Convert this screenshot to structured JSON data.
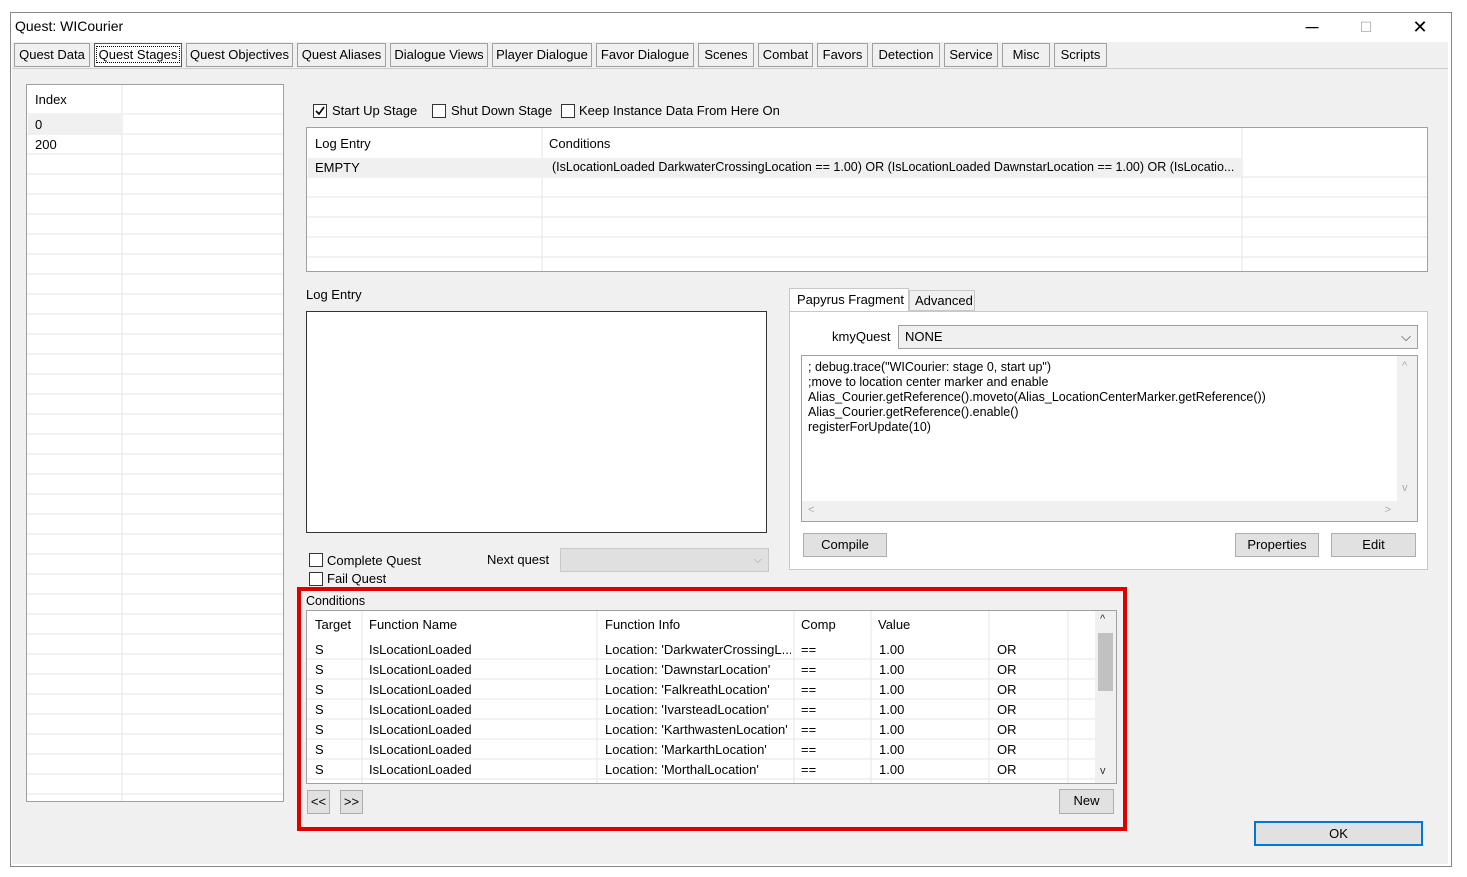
{
  "window": {
    "title": "Quest: WICourier",
    "min_label": "─",
    "max_label": "☐",
    "close_label": "✕"
  },
  "tabs": [
    "Quest Data",
    "Quest Stages",
    "Quest Objectives",
    "Quest Aliases",
    "Dialogue Views",
    "Player Dialogue",
    "Favor Dialogue",
    "Scenes",
    "Combat",
    "Favors",
    "Detection",
    "Service",
    "Misc",
    "Scripts"
  ],
  "index_list": {
    "header": "Index",
    "items": [
      "0",
      "200"
    ]
  },
  "stage_flags": {
    "start_up": "Start Up Stage",
    "shut_down": "Shut Down Stage",
    "keep_instance": "Keep Instance Data From Here On"
  },
  "log_table": {
    "headers": [
      "Log Entry",
      "Conditions"
    ],
    "rows": [
      [
        "EMPTY",
        "(IsLocationLoaded DarkwaterCrossingLocation == 1.00) OR (IsLocationLoaded DawnstarLocation == 1.00) OR (IsLocatio..."
      ]
    ]
  },
  "log_entry_label": "Log Entry",
  "complete_quest": "Complete Quest",
  "fail_quest": "Fail Quest",
  "next_quest_label": "Next quest",
  "papyrus": {
    "tab_fragment": "Papyrus Fragment",
    "tab_advanced": "Advanced",
    "kmyquest_label": "kmyQuest",
    "kmyquest_value": "NONE",
    "code": "; debug.trace(\"WICourier: stage 0, start up\")\n;move to location center marker and enable\nAlias_Courier.getReference().moveto(Alias_LocationCenterMarker.getReference())\nAlias_Courier.getReference().enable()\nregisterForUpdate(10)",
    "compile": "Compile",
    "properties": "Properties",
    "edit": "Edit"
  },
  "conditions": {
    "label": "Conditions",
    "headers": [
      "Target",
      "Function Name",
      "Function Info",
      "Comp",
      "Value",
      ""
    ],
    "rows": [
      [
        "S",
        "IsLocationLoaded",
        "Location: 'DarkwaterCrossingL...",
        "==",
        "1.00",
        "OR"
      ],
      [
        "S",
        "IsLocationLoaded",
        "Location: 'DawnstarLocation'",
        "==",
        "1.00",
        "OR"
      ],
      [
        "S",
        "IsLocationLoaded",
        "Location: 'FalkreathLocation'",
        "==",
        "1.00",
        "OR"
      ],
      [
        "S",
        "IsLocationLoaded",
        "Location: 'IvarsteadLocation'",
        "==",
        "1.00",
        "OR"
      ],
      [
        "S",
        "IsLocationLoaded",
        "Location: 'KarthwastenLocation'",
        "==",
        "1.00",
        "OR"
      ],
      [
        "S",
        "IsLocationLoaded",
        "Location: 'MarkarthLocation'",
        "==",
        "1.00",
        "OR"
      ],
      [
        "S",
        "IsLocationLoaded",
        "Location: 'MorthalLocation'",
        "==",
        "1.00",
        "OR"
      ]
    ],
    "prev": "<<",
    "next": ">>",
    "new": "New"
  },
  "ok": "OK",
  "colors": {
    "highlight": "#e00000",
    "panel": "#f0f0f0",
    "ok_border": "#0078d7"
  }
}
